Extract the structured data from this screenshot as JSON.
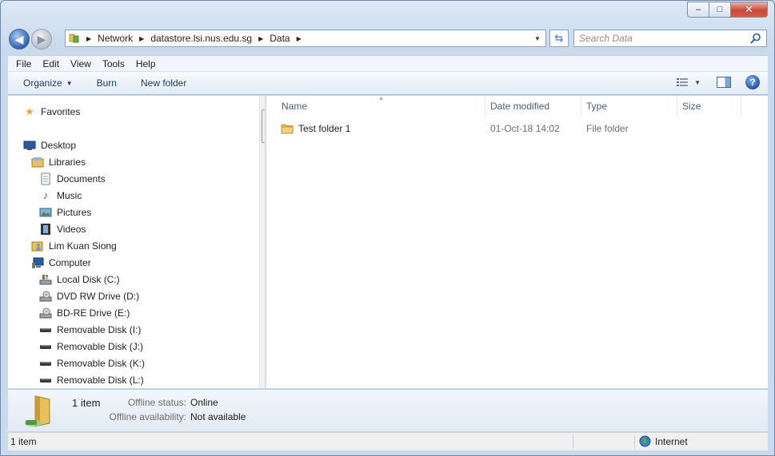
{
  "window": {
    "minimize": "‒",
    "maximize": "□",
    "close": "✕"
  },
  "address": {
    "crumbs": [
      "Network",
      "datastore.lsi.nus.edu.sg",
      "Data"
    ],
    "search_placeholder": "Search Data"
  },
  "menu": [
    "File",
    "Edit",
    "View",
    "Tools",
    "Help"
  ],
  "commands": {
    "organize": "Organize",
    "burn": "Burn",
    "new_folder": "New folder"
  },
  "nav_tree": [
    {
      "label": "Favorites",
      "icon": "star-icon"
    },
    {
      "label": "Desktop",
      "icon": "desktop-icon"
    },
    {
      "label": "Libraries",
      "icon": "libraries-icon"
    },
    {
      "label": "Documents",
      "icon": "documents-icon"
    },
    {
      "label": "Music",
      "icon": "music-icon"
    },
    {
      "label": "Pictures",
      "icon": "pictures-icon"
    },
    {
      "label": "Videos",
      "icon": "videos-icon"
    },
    {
      "label": "Lim Kuan Siong",
      "icon": "user-folder-icon"
    },
    {
      "label": "Computer",
      "icon": "computer-icon"
    },
    {
      "label": "Local Disk (C:)",
      "icon": "local-disk-icon"
    },
    {
      "label": "DVD RW Drive (D:)",
      "icon": "dvd-drive-icon"
    },
    {
      "label": "BD-RE Drive (E:)",
      "icon": "bd-drive-icon"
    },
    {
      "label": "Removable Disk (I:)",
      "icon": "removable-disk-icon"
    },
    {
      "label": "Removable Disk (J:)",
      "icon": "removable-disk-icon"
    },
    {
      "label": "Removable Disk (K:)",
      "icon": "removable-disk-icon"
    },
    {
      "label": "Removable Disk (L:)",
      "icon": "removable-disk-icon"
    }
  ],
  "columns": {
    "name": "Name",
    "date": "Date modified",
    "type": "Type",
    "size": "Size"
  },
  "files": [
    {
      "name": "Test folder 1",
      "date": "01-Oct-18 14:02",
      "type": "File folder",
      "size": ""
    }
  ],
  "details": {
    "count": "1 item",
    "offline_status_label": "Offline status:",
    "offline_status_value": "Online",
    "offline_avail_label": "Offline availability:",
    "offline_avail_value": "Not available"
  },
  "status": {
    "count": "1 item",
    "zone": "Internet"
  },
  "colors": {
    "accent": "#2f62b4",
    "folder": "#e8c15a"
  }
}
